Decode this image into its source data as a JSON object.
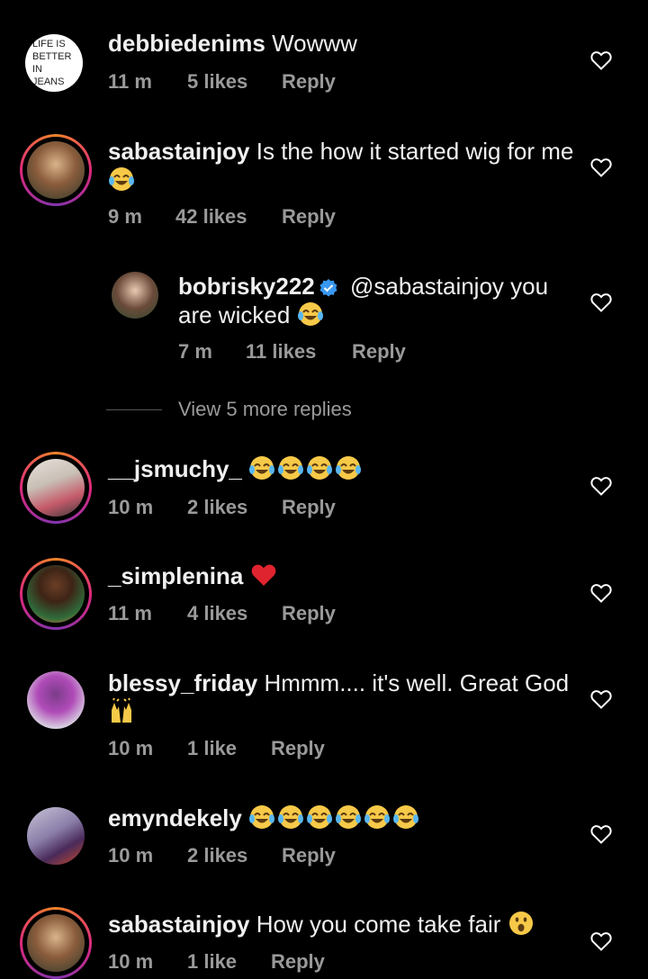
{
  "comments": [
    {
      "username": "debbiedenims",
      "text": "Wowww",
      "time": "11 m",
      "likes": "5 likes",
      "reply": "Reply",
      "avatar_text": [
        "LIFE IS",
        "BETTER",
        "IN",
        "JEANS"
      ],
      "emojis": []
    },
    {
      "username": "sabastainjoy",
      "text": "Is the how it started wig for me",
      "time": "9 m",
      "likes": "42 likes",
      "reply": "Reply",
      "emojis": [
        "tears-of-joy"
      ]
    },
    {
      "username": "bobrisky222",
      "verified": true,
      "text": "@sabastainjoy you are wicked",
      "time": "7 m",
      "likes": "11 likes",
      "reply": "Reply",
      "emojis": [
        "tears-of-joy"
      ]
    },
    {
      "username": "__jsmuchy_",
      "text": "",
      "time": "10 m",
      "likes": "2 likes",
      "reply": "Reply",
      "emojis": [
        "tears-of-joy",
        "tears-of-joy",
        "tears-of-joy",
        "tears-of-joy"
      ]
    },
    {
      "username": "_simplenina",
      "text": "",
      "time": "11 m",
      "likes": "4 likes",
      "reply": "Reply",
      "emojis": [
        "red-heart"
      ]
    },
    {
      "username": "blessy_friday",
      "text": "Hmmm.... it's well. Great God",
      "time": "10 m",
      "likes": "1 like",
      "reply": "Reply",
      "emojis": [
        "raising-hands"
      ]
    },
    {
      "username": "emyndekely",
      "text": "",
      "time": "10 m",
      "likes": "2 likes",
      "reply": "Reply",
      "emojis": [
        "tears-of-joy",
        "tears-of-joy",
        "tears-of-joy",
        "tears-of-joy",
        "tears-of-joy",
        "tears-of-joy"
      ]
    },
    {
      "username": "sabastainjoy",
      "text": "How you come take fair",
      "time": "10 m",
      "likes": "1 like",
      "reply": "Reply",
      "emojis": [
        "face-with-open-mouth"
      ]
    }
  ],
  "view_more_replies": "View 5 more replies",
  "colors": {
    "background": "#000000",
    "text": "#f0f0f0",
    "meta": "#9a9a9a",
    "verified": "#3897f0",
    "story_ring": "#dd2a7b"
  }
}
